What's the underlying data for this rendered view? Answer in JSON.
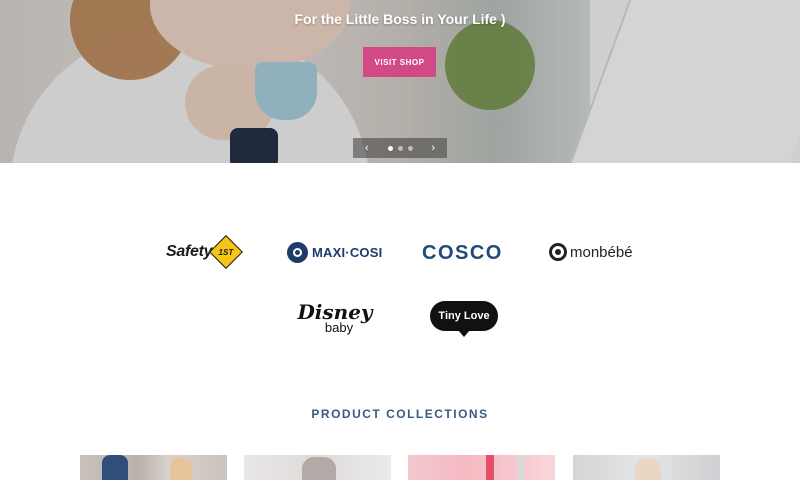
{
  "hero": {
    "title": "For the Little Boss in Your Life )",
    "cta_label": "VISIT SHOP",
    "slider": {
      "prev_icon": "chevron-left-icon",
      "next_icon": "chevron-right-icon",
      "prev_glyph": "‹",
      "next_glyph": "›",
      "slide_count": 3,
      "active_slide": 1
    },
    "cta_color": "#d14a86"
  },
  "brands": {
    "safety_first": {
      "name": "Safety",
      "badge": "1ST"
    },
    "maxi_cosi": {
      "name": "MAXI·COSI"
    },
    "cosco": {
      "name": "COSCO"
    },
    "monbebe": {
      "name": "monbébé"
    },
    "disney_baby": {
      "line1": "Disney",
      "line2": "baby"
    },
    "tiny_love": {
      "name": "Tiny Love"
    }
  },
  "collections": {
    "title": "PRODUCT COLLECTIONS",
    "title_color": "#3a5a82"
  }
}
